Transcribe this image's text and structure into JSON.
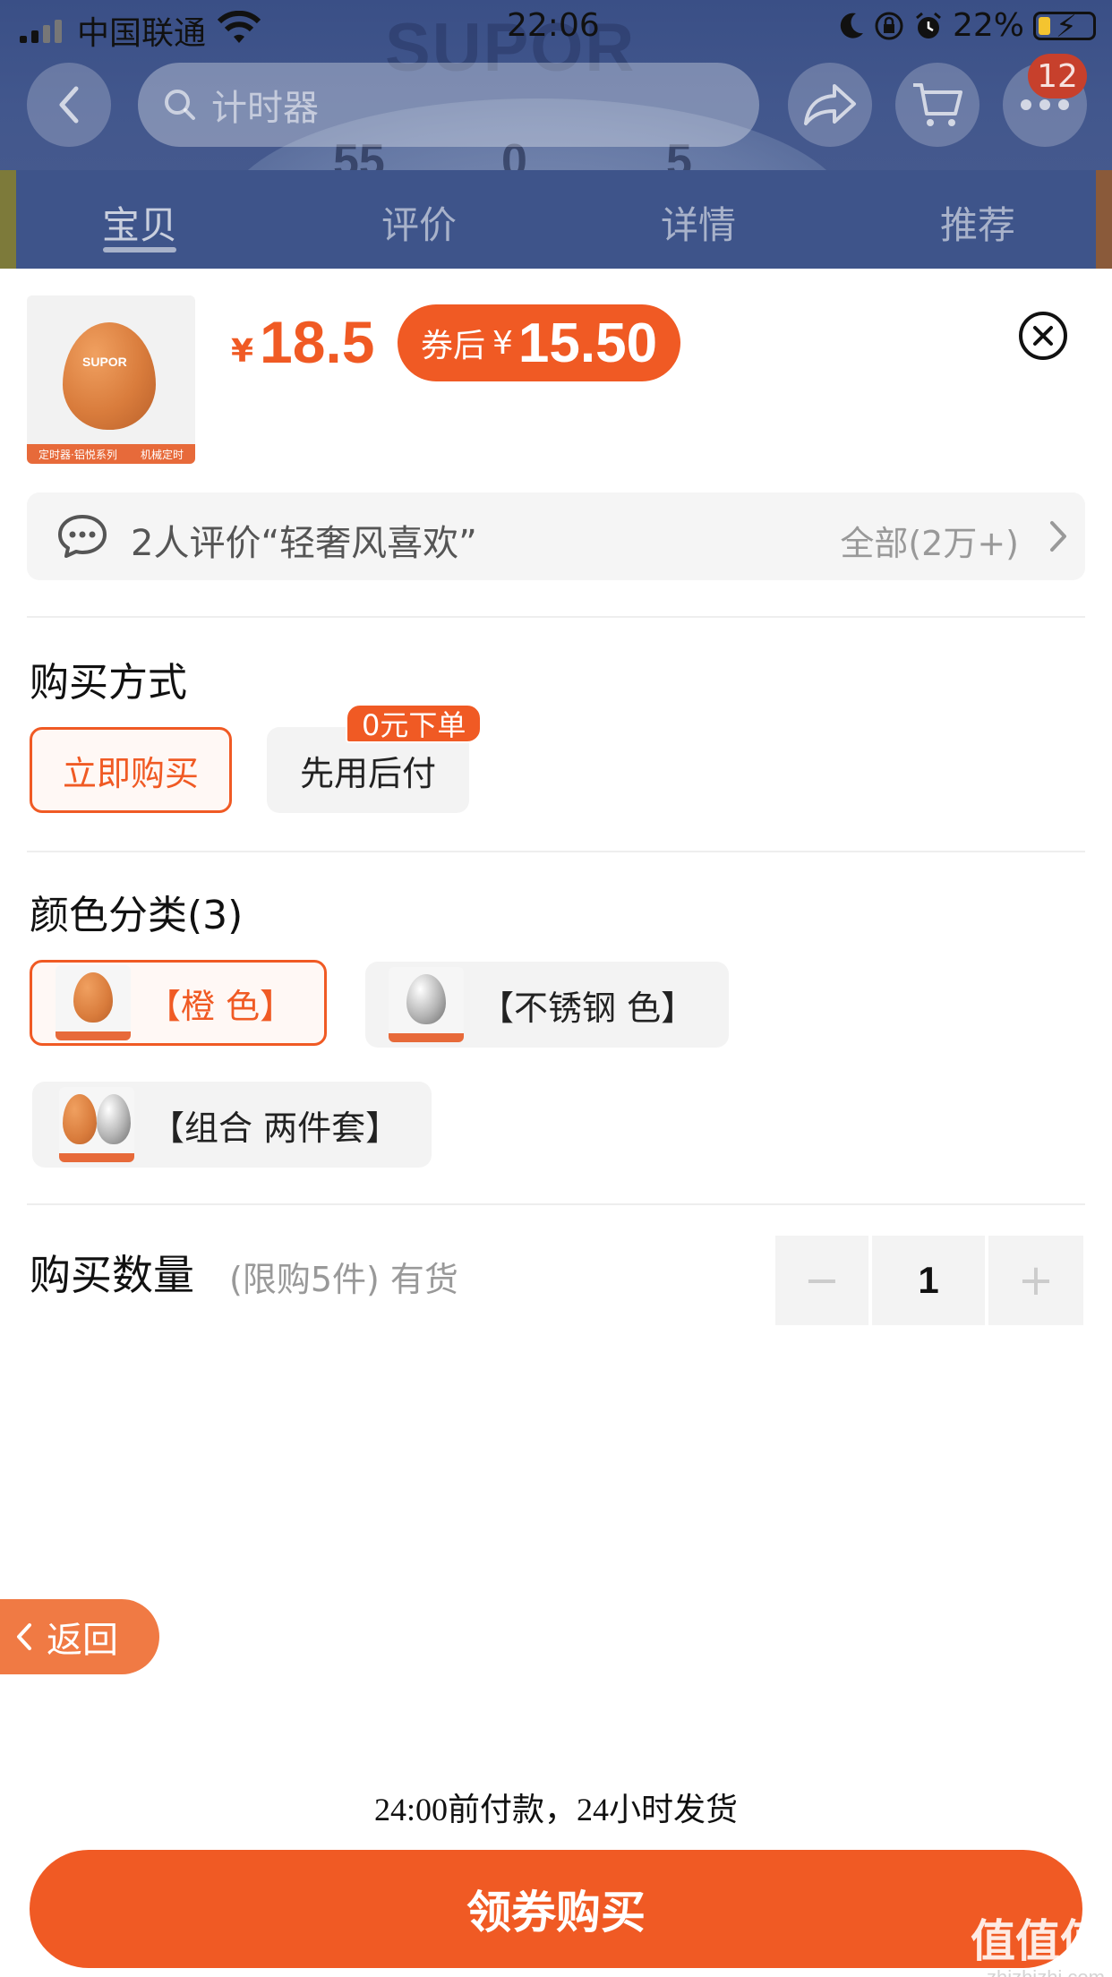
{
  "status_bar": {
    "carrier": "中国联通",
    "time": "22:06",
    "battery_text": "22%"
  },
  "nav": {
    "search_placeholder": "计时器",
    "menu_badge": "12"
  },
  "background_marks": {
    "brand": "SUPOR",
    "ticks": [
      "55",
      "0",
      "5"
    ]
  },
  "tabs": [
    {
      "label": "宝贝",
      "active": true
    },
    {
      "label": "评价",
      "active": false
    },
    {
      "label": "详情",
      "active": false
    },
    {
      "label": "推荐",
      "active": false
    }
  ],
  "product": {
    "currency": "¥",
    "price": "18.5",
    "coupon_label": "券后",
    "coupon_currency": "¥",
    "coupon_price": "15.50",
    "thumb_brand": "SUPOR",
    "thumb_tags": [
      "定时器·铝悦系列",
      "机械定时"
    ]
  },
  "review": {
    "text": "2人评价“轻奢风喜欢”",
    "all": "全部(2万+)"
  },
  "purchase_method": {
    "title": "购买方式",
    "options": [
      {
        "label": "立即购买",
        "selected": true
      },
      {
        "label": "先用后付",
        "selected": false
      }
    ],
    "tag": "0元下单"
  },
  "color": {
    "title": "颜色分类(3)",
    "options": [
      {
        "label": "【橙 色】",
        "selected": true
      },
      {
        "label": "【不锈钢 色】",
        "selected": false
      },
      {
        "label": "【组合 两件套】",
        "selected": false
      }
    ]
  },
  "quantity": {
    "title": "购买数量",
    "note": "(限购5件) 有货",
    "minus": "−",
    "value": "1",
    "plus": "+"
  },
  "back_button": "返回",
  "payment_note": "24:00前付款，24小时发货",
  "buy_button": "领券购买",
  "watermark": {
    "logo": "值值值",
    "url": "zhizhizhi.com"
  },
  "colors": {
    "accent": "#f05a24",
    "back_button": "#f07a44"
  }
}
